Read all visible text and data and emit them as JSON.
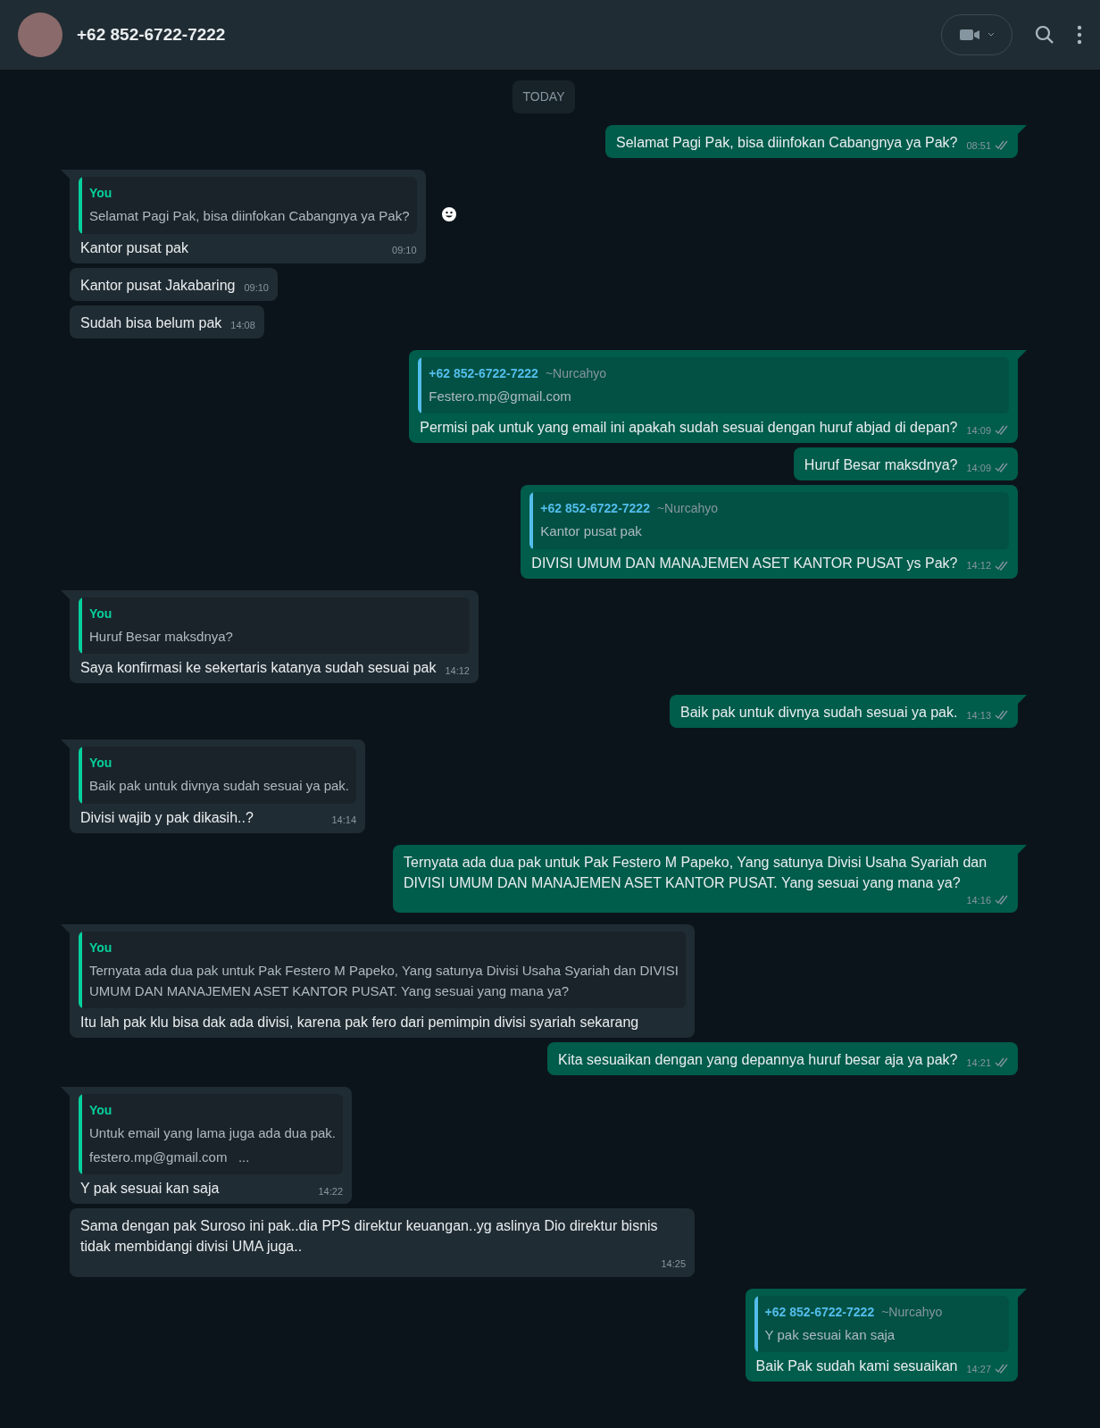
{
  "header": {
    "contact": "+62 852-6722-7222"
  },
  "date_chip": "TODAY",
  "messages": [
    {
      "kind": "out",
      "tail": true,
      "text": "Selamat Pagi Pak, bisa diinfokan Cabangnya ya Pak?",
      "time": "08:51"
    },
    {
      "kind": "in",
      "tail": true,
      "react": true,
      "quote": {
        "author": "You",
        "lines": [
          "Selamat Pagi Pak, bisa diinfokan Cabangnya ya Pak?"
        ]
      },
      "text": "Kantor pusat pak",
      "time": "09:10"
    },
    {
      "kind": "in",
      "tail": false,
      "text": "Kantor pusat Jakabaring",
      "time": "09:10"
    },
    {
      "kind": "in",
      "tail": false,
      "text": "Sudah bisa belum pak",
      "time": "14:08"
    },
    {
      "kind": "out",
      "tail": true,
      "quote": {
        "author": "+62 852-6722-7222",
        "alias": "~Nurcahyo",
        "lines": [
          "Festero.mp@gmail.com"
        ]
      },
      "text": "Permisi pak untuk yang email ini apakah sudah sesuai dengan huruf abjad di depan?",
      "time": "14:09"
    },
    {
      "kind": "out",
      "tail": false,
      "text": "Huruf Besar maksdnya?",
      "time": "14:09"
    },
    {
      "kind": "out",
      "tail": false,
      "quote": {
        "author": "+62 852-6722-7222",
        "alias": "~Nurcahyo",
        "lines": [
          "Kantor pusat pak"
        ]
      },
      "text": "DIVISI UMUM DAN MANAJEMEN ASET KANTOR PUSAT ys Pak?",
      "time": "14:12"
    },
    {
      "kind": "in",
      "tail": true,
      "quote": {
        "author": "You",
        "lines": [
          "Huruf Besar maksdnya?"
        ]
      },
      "text": "Saya konfirmasi ke sekertaris katanya sudah sesuai pak",
      "time": "14:12"
    },
    {
      "kind": "out",
      "tail": true,
      "text": "Baik pak untuk divnya sudah sesuai ya pak.",
      "time": "14:13"
    },
    {
      "kind": "in",
      "tail": true,
      "quote": {
        "author": "You",
        "lines": [
          "Baik pak untuk divnya sudah sesuai ya pak."
        ]
      },
      "text": "Divisi wajib y pak dikasih..?",
      "time": "14:14"
    },
    {
      "kind": "out",
      "tail": true,
      "text": "Ternyata ada dua pak untuk Pak Festero M Papeko, Yang satunya Divisi Usaha Syariah dan DIVISI UMUM DAN MANAJEMEN ASET KANTOR PUSAT. Yang sesuai yang mana ya?",
      "time": "14:16"
    },
    {
      "kind": "in",
      "tail": true,
      "quote": {
        "author": "You",
        "lines": [
          "Ternyata ada dua pak untuk Pak Festero M Papeko, Yang satunya Divisi Usaha Syariah dan DIVISI UMUM DAN MANAJEMEN ASET KANTOR PUSAT. Yang sesuai yang mana ya?"
        ]
      },
      "text": "Itu lah pak klu bisa dak ada divisi, karena pak fero dari pemimpin divisi syariah sekarang"
    },
    {
      "kind": "out",
      "tail": false,
      "text": "Kita sesuaikan dengan yang depannya huruf besar aja ya pak?",
      "time": "14:21"
    },
    {
      "kind": "in",
      "tail": true,
      "quote": {
        "author": "You",
        "lines": [
          "Untuk email yang lama juga ada dua pak.",
          "festero.mp@gmail.com   ..."
        ]
      },
      "text": "Y pak sesuai kan saja",
      "time": "14:22"
    },
    {
      "kind": "in",
      "tail": false,
      "text": "Sama dengan pak Suroso ini pak..dia PPS direktur keuangan..yg aslinya Dio direktur bisnis tidak membidangi divisi UMA juga..",
      "time": "14:25"
    },
    {
      "kind": "out",
      "tail": true,
      "quote": {
        "author": "+62 852-6722-7222",
        "alias": "~Nurcahyo",
        "lines": [
          "Y pak sesuai kan saja"
        ]
      },
      "text": "Baik Pak sudah kami sesuaikan",
      "time": "14:27"
    }
  ]
}
